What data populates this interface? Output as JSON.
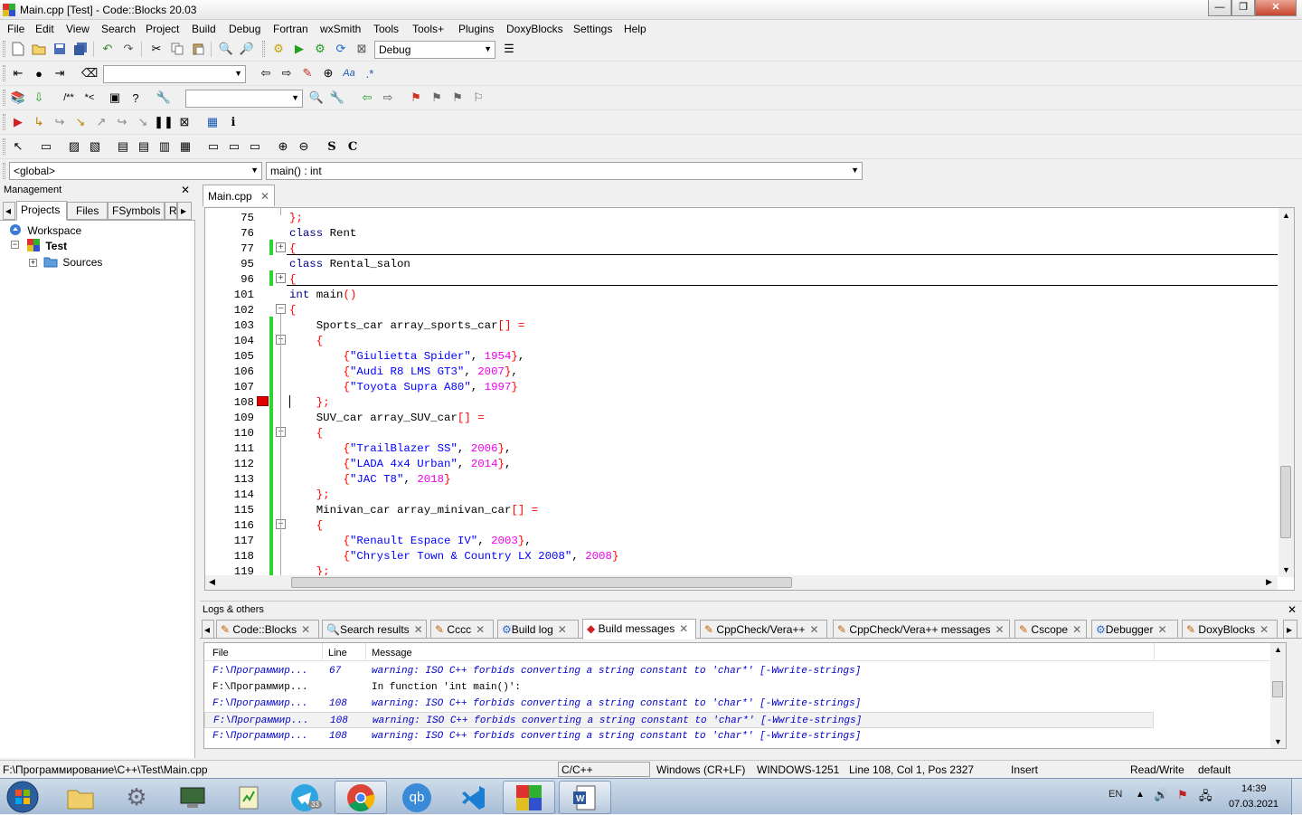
{
  "window": {
    "title": "Main.cpp [Test] - Code::Blocks 20.03",
    "min": "—",
    "max": "❐",
    "close": "✕"
  },
  "menu": [
    "File",
    "Edit",
    "View",
    "Search",
    "Project",
    "Build",
    "Debug",
    "Fortran",
    "wxSmith",
    "Tools",
    "Tools+",
    "Plugins",
    "DoxyBlocks",
    "Settings",
    "Help"
  ],
  "toolbar": {
    "build_target": "Debug",
    "scope": "<global>",
    "function": "main() : int"
  },
  "management": {
    "title": "Management",
    "tabs": [
      "Projects",
      "Files",
      "FSymbols",
      "R"
    ],
    "tree": {
      "workspace": "Workspace",
      "project": "Test",
      "folder": "Sources"
    }
  },
  "editor": {
    "tab": "Main.cpp",
    "lines": [
      {
        "n": "75",
        "t": "};"
      },
      {
        "n": "76",
        "t": "class Rent"
      },
      {
        "n": "77",
        "t": "{"
      },
      {
        "n": "95",
        "t": "class Rental_salon"
      },
      {
        "n": "96",
        "t": "{"
      },
      {
        "n": "101",
        "t": "int main()"
      },
      {
        "n": "102",
        "t": "{"
      },
      {
        "n": "103",
        "t": "    Sports_car array_sports_car[] ="
      },
      {
        "n": "104",
        "t": "    {"
      },
      {
        "n": "105",
        "t": "        {\"Giulietta Spider\", 1954},"
      },
      {
        "n": "106",
        "t": "        {\"Audi R8 LMS GT3\", 2007},"
      },
      {
        "n": "107",
        "t": "        {\"Toyota Supra A80\", 1997}"
      },
      {
        "n": "108",
        "t": "    };"
      },
      {
        "n": "109",
        "t": "    SUV_car array_SUV_car[] ="
      },
      {
        "n": "110",
        "t": "    {"
      },
      {
        "n": "111",
        "t": "        {\"TrailBlazer SS\", 2006},"
      },
      {
        "n": "112",
        "t": "        {\"LADA 4x4 Urban\", 2014},"
      },
      {
        "n": "113",
        "t": "        {\"JAC T8\", 2018}"
      },
      {
        "n": "114",
        "t": "    };"
      },
      {
        "n": "115",
        "t": "    Minivan_car array_minivan_car[] ="
      },
      {
        "n": "116",
        "t": "    {"
      },
      {
        "n": "117",
        "t": "        {\"Renault Espace IV\", 2003},"
      },
      {
        "n": "118",
        "t": "        {\"Chrysler Town & Country LX 2008\", 2008}"
      },
      {
        "n": "119",
        "t": "    };"
      }
    ]
  },
  "logs": {
    "title": "Logs & others",
    "tabs": [
      "Code::Blocks",
      "Search results",
      "Cccc",
      "Build log",
      "Build messages",
      "CppCheck/Vera++",
      "CppCheck/Vera++ messages",
      "Cscope",
      "Debugger",
      "DoxyBlocks"
    ],
    "columns": [
      "File",
      "Line",
      "Message"
    ],
    "rows": [
      {
        "file": "F:\\Программир...",
        "line": "67",
        "msg": "warning: ISO C++ forbids converting a string constant to 'char*' [-Wwrite-strings]",
        "warn": true
      },
      {
        "file": "F:\\Программир...",
        "line": "",
        "msg": "In function 'int main()':",
        "warn": false
      },
      {
        "file": "F:\\Программир...",
        "line": "108",
        "msg": "warning: ISO C++ forbids converting a string constant to 'char*' [-Wwrite-strings]",
        "warn": true
      },
      {
        "file": "F:\\Программир...",
        "line": "108",
        "msg": "warning: ISO C++ forbids converting a string constant to 'char*' [-Wwrite-strings]",
        "warn": true
      },
      {
        "file": "F:\\Программир...",
        "line": "108",
        "msg": "warning: ISO C++ forbids converting a string constant to 'char*' [-Wwrite-strings]",
        "warn": true
      }
    ]
  },
  "status": {
    "path": "F:\\Программирование\\C++\\Test\\Main.cpp",
    "lang": "C/C++",
    "eol": "Windows (CR+LF)",
    "encoding": "WINDOWS-1251",
    "pos": "Line 108, Col 1, Pos 2327",
    "mode": "Insert",
    "rw": "Read/Write",
    "profile": "default"
  },
  "taskbar": {
    "lang": "EN",
    "time": "14:39",
    "date": "07.03.2021",
    "qb_label": "qb",
    "tg_badge": "33"
  },
  "colors": {
    "keyword": "#00008b",
    "string": "#0000ff",
    "number": "#f000f0",
    "operator": "#ff0000",
    "changebar": "#2ed52e",
    "breakpoint": "#e00000"
  }
}
